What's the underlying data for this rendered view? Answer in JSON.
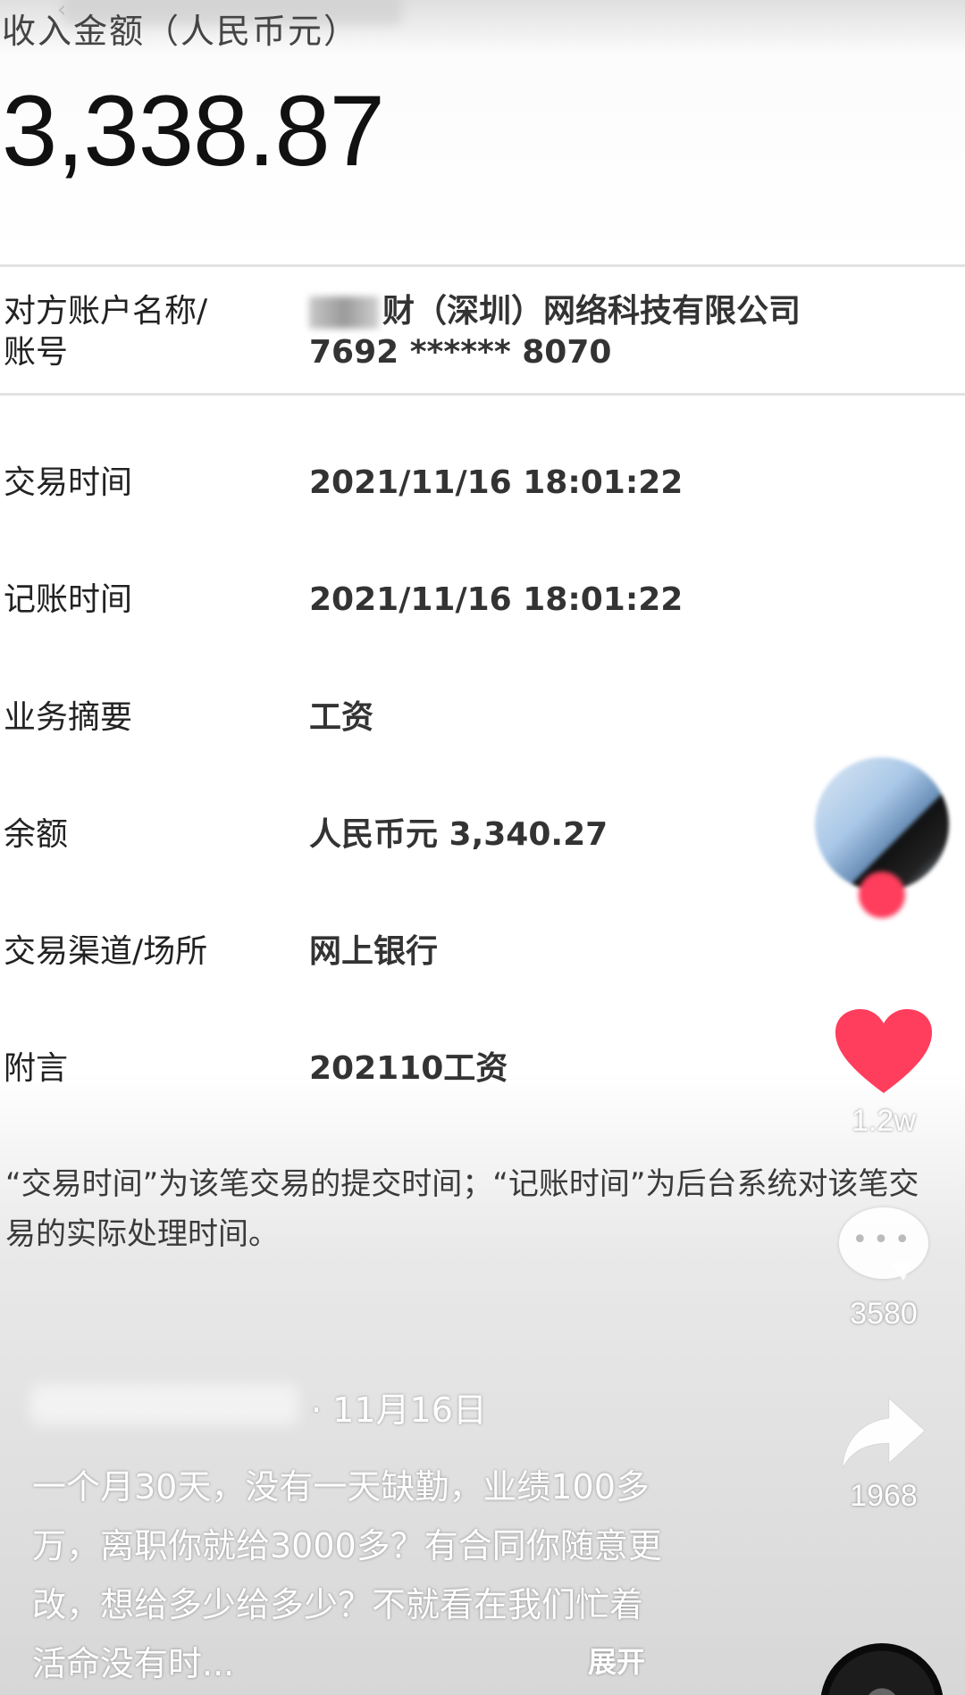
{
  "header": {
    "amount_label": "收入金额（人民币元）",
    "amount": "3,338.87"
  },
  "details": [
    {
      "label_lines": [
        "对方账户名称/",
        "账号"
      ],
      "value_lines": [
        "财（深圳）网络科技有限公司",
        "7692 ****** 8070"
      ]
    },
    {
      "label": "交易时间",
      "value": "2021/11/16  18:01:22"
    },
    {
      "label": "记账时间",
      "value": "2021/11/16  18:01:22"
    },
    {
      "label": "业务摘要",
      "value": "工资"
    },
    {
      "label": "余额",
      "value": "人民币元 3,340.27"
    },
    {
      "label": "交易渠道/场所",
      "value": "网上银行"
    },
    {
      "label": "附言",
      "value": "202110工资"
    }
  ],
  "note": "“交易时间”为该笔交易的提交时间；“记账时间”为后台系统对该笔交易的实际处理时间。",
  "rail": {
    "likes": "1.2w",
    "comments": "3580",
    "shares": "1968"
  },
  "post": {
    "date": "· 11月16日",
    "caption": "一个月30天，没有一天缺勤，业绩100多万，离职你就给3000多？有合同你随意更改，想给多少给多少？不就看在我们忙着活命没有时...",
    "expand_label": "展开"
  },
  "icons": {
    "like": "heart-icon",
    "comment": "comment-icon",
    "share": "share-icon",
    "back": "chevron-left-icon"
  },
  "colors": {
    "like": "#ff3d5c",
    "text": "#1d1d1d",
    "divider": "#e2e2e2"
  }
}
